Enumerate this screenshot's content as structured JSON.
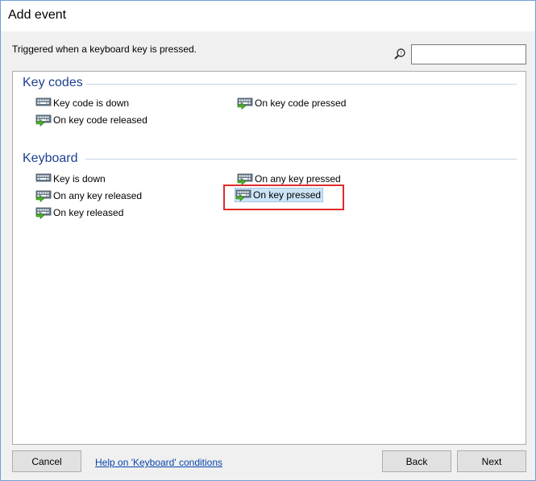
{
  "window": {
    "title": "Add event"
  },
  "description": "Triggered when a keyboard key is pressed.",
  "search": {
    "value": "",
    "placeholder": ""
  },
  "groups": [
    {
      "header": "Key codes",
      "items": [
        {
          "label": "Key code is down",
          "icon": "keyboard-icon"
        },
        {
          "label": "On key code pressed",
          "icon": "keyboard-trigger-icon"
        },
        {
          "label": "On key code released",
          "icon": "keyboard-trigger-icon"
        }
      ]
    },
    {
      "header": "Keyboard",
      "items": [
        {
          "label": "Key is down",
          "icon": "keyboard-icon"
        },
        {
          "label": "On any key pressed",
          "icon": "keyboard-trigger-icon"
        },
        {
          "label": "On any key released",
          "icon": "keyboard-trigger-icon"
        },
        {
          "label": "On key pressed",
          "icon": "keyboard-trigger-icon",
          "selected": true
        },
        {
          "label": "On key released",
          "icon": "keyboard-trigger-icon"
        }
      ]
    }
  ],
  "footer": {
    "cancel_label": "Cancel",
    "help_label": "Help on 'Keyboard' conditions",
    "back_label": "Back",
    "next_label": "Next"
  },
  "colors": {
    "group_header": "#1e3f8f",
    "selection": "#cce4f7",
    "highlight": "#e02b2b",
    "link": "#0645ad"
  }
}
